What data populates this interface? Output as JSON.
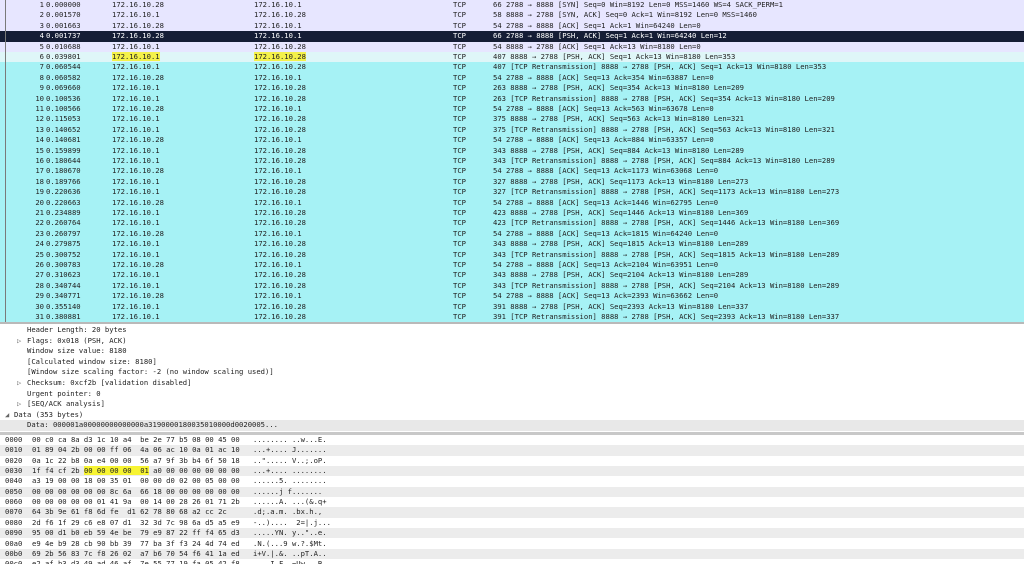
{
  "packet_list": {
    "rows": [
      {
        "no": "1",
        "time": "0.000000",
        "src": "172.16.10.28",
        "dst": "172.16.10.1",
        "proto": "TCP",
        "info": "66 2788 → 8888 [SYN] Seq=0 Win=8192 Len=0 MSS=1460 WS=4 SACK_PERM=1",
        "style": "tcp"
      },
      {
        "no": "2",
        "time": "0.001570",
        "src": "172.16.10.1",
        "dst": "172.16.10.28",
        "proto": "TCP",
        "info": "58 8888 → 2788 [SYN, ACK] Seq=0 Ack=1 Win=8192 Len=0 MSS=1460",
        "style": "tcp"
      },
      {
        "no": "3",
        "time": "0.001663",
        "src": "172.16.10.28",
        "dst": "172.16.10.1",
        "proto": "TCP",
        "info": "54 2788 → 8888 [ACK] Seq=1 Ack=1 Win=64240 Len=0",
        "style": "tcp"
      },
      {
        "no": "4",
        "time": "0.001737",
        "src": "172.16.10.28",
        "dst": "172.16.10.1",
        "proto": "TCP",
        "info": "66 2788 → 8888 [PSH, ACK] Seq=1 Ack=1 Win=64240 Len=12",
        "style": "sel"
      },
      {
        "no": "5",
        "time": "0.010688",
        "src": "172.16.10.1",
        "dst": "172.16.10.28",
        "proto": "TCP",
        "info": "54 8888 → 2788 [ACK] Seq=1 Ack=13 Win=8180 Len=0",
        "style": "tcp"
      },
      {
        "no": "6",
        "time": "0.039801",
        "src": "172.16.10.1",
        "dst": "172.16.10.28",
        "proto": "TCP",
        "info": "407 8888 → 2788 [PSH, ACK] Seq=1 Ack=13 Win=8180 Len=353",
        "style": "hl"
      },
      {
        "no": "7",
        "time": "0.060544",
        "src": "172.16.10.1",
        "dst": "172.16.10.28",
        "proto": "TCP",
        "info": "407 [TCP Retransmission] 8888 → 2788 [PSH, ACK] Seq=1 Ack=13 Win=8180 Len=353",
        "style": "retrans"
      },
      {
        "no": "8",
        "time": "0.060582",
        "src": "172.16.10.28",
        "dst": "172.16.10.1",
        "proto": "TCP",
        "info": "54 2788 → 8888 [ACK] Seq=13 Ack=354 Win=63887 Len=0",
        "style": "retrans"
      },
      {
        "no": "9",
        "time": "0.069660",
        "src": "172.16.10.1",
        "dst": "172.16.10.28",
        "proto": "TCP",
        "info": "263 8888 → 2788 [PSH, ACK] Seq=354 Ack=13 Win=8180 Len=209",
        "style": "retrans"
      },
      {
        "no": "10",
        "time": "0.100536",
        "src": "172.16.10.1",
        "dst": "172.16.10.28",
        "proto": "TCP",
        "info": "263 [TCP Retransmission] 8888 → 2788 [PSH, ACK] Seq=354 Ack=13 Win=8180 Len=209",
        "style": "retrans"
      },
      {
        "no": "11",
        "time": "0.100566",
        "src": "172.16.10.28",
        "dst": "172.16.10.1",
        "proto": "TCP",
        "info": "54 2788 → 8888 [ACK] Seq=13 Ack=563 Win=63678 Len=0",
        "style": "retrans"
      },
      {
        "no": "12",
        "time": "0.115053",
        "src": "172.16.10.1",
        "dst": "172.16.10.28",
        "proto": "TCP",
        "info": "375 8888 → 2788 [PSH, ACK] Seq=563 Ack=13 Win=8180 Len=321",
        "style": "retrans"
      },
      {
        "no": "13",
        "time": "0.140652",
        "src": "172.16.10.1",
        "dst": "172.16.10.28",
        "proto": "TCP",
        "info": "375 [TCP Retransmission] 8888 → 2788 [PSH, ACK] Seq=563 Ack=13 Win=8180 Len=321",
        "style": "retrans"
      },
      {
        "no": "14",
        "time": "0.140681",
        "src": "172.16.10.28",
        "dst": "172.16.10.1",
        "proto": "TCP",
        "info": "54 2788 → 8888 [ACK] Seq=13 Ack=884 Win=63357 Len=0",
        "style": "retrans"
      },
      {
        "no": "15",
        "time": "0.159899",
        "src": "172.16.10.1",
        "dst": "172.16.10.28",
        "proto": "TCP",
        "info": "343 8888 → 2788 [PSH, ACK] Seq=884 Ack=13 Win=8180 Len=289",
        "style": "retrans"
      },
      {
        "no": "16",
        "time": "0.180644",
        "src": "172.16.10.1",
        "dst": "172.16.10.28",
        "proto": "TCP",
        "info": "343 [TCP Retransmission] 8888 → 2788 [PSH, ACK] Seq=884 Ack=13 Win=8180 Len=289",
        "style": "retrans"
      },
      {
        "no": "17",
        "time": "0.180670",
        "src": "172.16.10.28",
        "dst": "172.16.10.1",
        "proto": "TCP",
        "info": "54 2788 → 8888 [ACK] Seq=13 Ack=1173 Win=63068 Len=0",
        "style": "retrans"
      },
      {
        "no": "18",
        "time": "0.189766",
        "src": "172.16.10.1",
        "dst": "172.16.10.28",
        "proto": "TCP",
        "info": "327 8888 → 2788 [PSH, ACK] Seq=1173 Ack=13 Win=8180 Len=273",
        "style": "retrans"
      },
      {
        "no": "19",
        "time": "0.220636",
        "src": "172.16.10.1",
        "dst": "172.16.10.28",
        "proto": "TCP",
        "info": "327 [TCP Retransmission] 8888 → 2788 [PSH, ACK] Seq=1173 Ack=13 Win=8180 Len=273",
        "style": "retrans"
      },
      {
        "no": "20",
        "time": "0.220663",
        "src": "172.16.10.28",
        "dst": "172.16.10.1",
        "proto": "TCP",
        "info": "54 2788 → 8888 [ACK] Seq=13 Ack=1446 Win=62795 Len=0",
        "style": "retrans"
      },
      {
        "no": "21",
        "time": "0.234889",
        "src": "172.16.10.1",
        "dst": "172.16.10.28",
        "proto": "TCP",
        "info": "423 8888 → 2788 [PSH, ACK] Seq=1446 Ack=13 Win=8180 Len=369",
        "style": "retrans"
      },
      {
        "no": "22",
        "time": "0.260764",
        "src": "172.16.10.1",
        "dst": "172.16.10.28",
        "proto": "TCP",
        "info": "423 [TCP Retransmission] 8888 → 2788 [PSH, ACK] Seq=1446 Ack=13 Win=8180 Len=369",
        "style": "retrans"
      },
      {
        "no": "23",
        "time": "0.260797",
        "src": "172.16.10.28",
        "dst": "172.16.10.1",
        "proto": "TCP",
        "info": "54 2788 → 8888 [ACK] Seq=13 Ack=1815 Win=64240 Len=0",
        "style": "retrans"
      },
      {
        "no": "24",
        "time": "0.279875",
        "src": "172.16.10.1",
        "dst": "172.16.10.28",
        "proto": "TCP",
        "info": "343 8888 → 2788 [PSH, ACK] Seq=1815 Ack=13 Win=8180 Len=289",
        "style": "retrans"
      },
      {
        "no": "25",
        "time": "0.300752",
        "src": "172.16.10.1",
        "dst": "172.16.10.28",
        "proto": "TCP",
        "info": "343 [TCP Retransmission] 8888 → 2788 [PSH, ACK] Seq=1815 Ack=13 Win=8180 Len=289",
        "style": "retrans"
      },
      {
        "no": "26",
        "time": "0.300783",
        "src": "172.16.10.28",
        "dst": "172.16.10.1",
        "proto": "TCP",
        "info": "54 2788 → 8888 [ACK] Seq=13 Ack=2104 Win=63951 Len=0",
        "style": "retrans"
      },
      {
        "no": "27",
        "time": "0.310623",
        "src": "172.16.10.1",
        "dst": "172.16.10.28",
        "proto": "TCP",
        "info": "343 8888 → 2788 [PSH, ACK] Seq=2104 Ack=13 Win=8180 Len=289",
        "style": "retrans"
      },
      {
        "no": "28",
        "time": "0.340744",
        "src": "172.16.10.1",
        "dst": "172.16.10.28",
        "proto": "TCP",
        "info": "343 [TCP Retransmission] 8888 → 2788 [PSH, ACK] Seq=2104 Ack=13 Win=8180 Len=289",
        "style": "retrans"
      },
      {
        "no": "29",
        "time": "0.340771",
        "src": "172.16.10.28",
        "dst": "172.16.10.1",
        "proto": "TCP",
        "info": "54 2788 → 8888 [ACK] Seq=13 Ack=2393 Win=63662 Len=0",
        "style": "retrans"
      },
      {
        "no": "30",
        "time": "0.355140",
        "src": "172.16.10.1",
        "dst": "172.16.10.28",
        "proto": "TCP",
        "info": "391 8888 → 2788 [PSH, ACK] Seq=2393 Ack=13 Win=8180 Len=337",
        "style": "retrans"
      },
      {
        "no": "31",
        "time": "0.380881",
        "src": "172.16.10.1",
        "dst": "172.16.10.28",
        "proto": "TCP",
        "info": "391 [TCP Retransmission] 8888 → 2788 [PSH, ACK] Seq=2393 Ack=13 Win=8180 Len=337",
        "style": "retrans"
      }
    ]
  },
  "details": {
    "rows": [
      {
        "text": "Header Length: 20 bytes",
        "expander": "",
        "level": "field",
        "style": ""
      },
      {
        "text": "Flags: 0x018 (PSH, ACK)",
        "expander": "▷",
        "level": "field",
        "style": ""
      },
      {
        "text": "Window size value: 8180",
        "expander": "",
        "level": "field",
        "style": ""
      },
      {
        "text": "[Calculated window size: 8180]",
        "expander": "",
        "level": "field",
        "style": ""
      },
      {
        "text": "[Window size scaling factor: -2 (no window scaling used)]",
        "expander": "",
        "level": "field",
        "style": ""
      },
      {
        "text": "Checksum: 0xcf2b [validation disabled]",
        "expander": "▷",
        "level": "field",
        "style": ""
      },
      {
        "text": "Urgent pointer: 0",
        "expander": "",
        "level": "field",
        "style": ""
      },
      {
        "text": "[SEQ/ACK analysis]",
        "expander": "▷",
        "level": "field",
        "style": ""
      },
      {
        "text": "Data (353 bytes)",
        "expander": "◢",
        "level": "sec",
        "style": ""
      },
      {
        "text": "Data: 000001a00000000000000a3190000180035010000d0020005...",
        "expander": "",
        "level": "field",
        "style": "bg"
      },
      {
        "text": "[Length: 353]",
        "expander": "",
        "level": "field",
        "style": ""
      }
    ]
  },
  "hex": {
    "rows": [
      {
        "offset": "0000",
        "bytes": "00 c0 ca 8a d3 1c 10 a4  be 2e 77 b5 08 00 45 00",
        "ascii": "........ ..w...E."
      },
      {
        "offset": "0010",
        "bytes": "01 89 04 2b 00 00 ff 06  4a 06 ac 10 0a 01 ac 10",
        "ascii": "...+.... J......."
      },
      {
        "offset": "0020",
        "bytes": "0a 1c 22 b8 0a e4 00 00  56 a7 9f 3b b4 6f 50 18",
        "ascii": "..\"..... V..;.oP."
      },
      {
        "offset": "0030",
        "bytes": "1f f4 cf 2b 00 00 00 00  01 a0 00 00 00 00 00 00",
        "ascii": "...+.... ........",
        "hl_before": "1f f4 cf 2b ",
        "hl": "00 00 00 00  01",
        "hl_after": " a0 00 00 00 00 00 00"
      },
      {
        "offset": "0040",
        "bytes": "a3 19 00 00 18 00 35 01  00 00 d0 02 00 05 00 00",
        "ascii": "......5. ........"
      },
      {
        "offset": "0050",
        "bytes": "00 00 00 00 00 00 8c 6a  66 18 00 00 00 00 00 00",
        "ascii": "......j f......."
      },
      {
        "offset": "0060",
        "bytes": "00 00 00 00 00 01 41 9a  00 14 00 28 26 01 71 2b",
        "ascii": "......A. ...(&.q+"
      },
      {
        "offset": "0070",
        "bytes": "64 3b 9e 61 f8 6d fe  d1 62 78 80 68 a2 cc 2c",
        "ascii": ".d;.a.m. .bx.h.,"
      },
      {
        "offset": "0080",
        "bytes": "2d f6 1f 29 c6 e8 07 d1  32 3d 7c 98 6a d5 a5 e9",
        "ascii": "-..)....  2=|.j..."
      },
      {
        "offset": "0090",
        "bytes": "95 00 d1 b0 eb 59 4e be  79 e9 87 22 ff f4 65 d3",
        "ascii": ".....YN. y..\"..e."
      },
      {
        "offset": "00a0",
        "bytes": "e9 4e b9 28 cb 90 bb 39  77 ba 3f f3 24 4d 74 ed",
        "ascii": ".N.(...9 w.?.$Mt."
      },
      {
        "offset": "00b0",
        "bytes": "69 2b 56 83 7c f8 26 02  a7 b6 70 54 f6 41 1a ed",
        "ascii": "i+V.|.&. ..pT.A.."
      },
      {
        "offset": "00c0",
        "bytes": "e2 af b3 d3 49 ad 46 af  7e 55 77 19 fa 05 42 f8",
        "ascii": "....I.F. ~Uw...B."
      }
    ]
  },
  "colors": {
    "tcp_row": "#e7e6ff",
    "retrans_row": "#a6f2f5",
    "selected_row": "#151d35",
    "highlight_yellow": "#f7f432"
  }
}
